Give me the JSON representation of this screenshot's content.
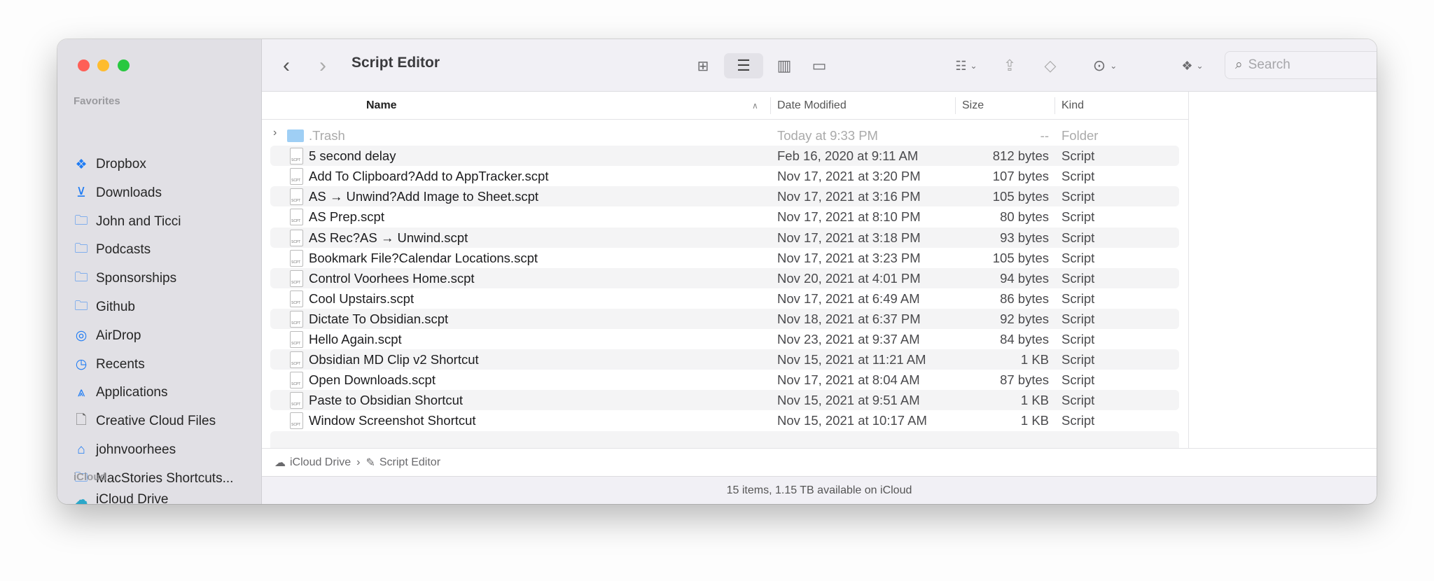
{
  "window": {
    "title": "Script Editor",
    "traffic_colors": {
      "close": "#fe5f57",
      "minimize": "#febc2e",
      "zoom": "#28c840"
    }
  },
  "toolbar": {
    "search_placeholder": "Search",
    "views": [
      "icon-view",
      "list-view",
      "column-view",
      "gallery-view"
    ],
    "selected_view": "list-view"
  },
  "sidebar": {
    "favorites_label": "Favorites",
    "favorites": [
      {
        "label": "Dropbox",
        "icon": "dropbox-icon"
      },
      {
        "label": "Downloads",
        "icon": "download-icon"
      },
      {
        "label": "John and Ticci",
        "icon": "folder-icon"
      },
      {
        "label": "Podcasts",
        "icon": "folder-icon"
      },
      {
        "label": "Sponsorships",
        "icon": "folder-icon"
      },
      {
        "label": "Github",
        "icon": "folder-icon"
      },
      {
        "label": "AirDrop",
        "icon": "airdrop-icon"
      },
      {
        "label": "Recents",
        "icon": "clock-icon"
      },
      {
        "label": "Applications",
        "icon": "applications-icon"
      },
      {
        "label": "Creative Cloud Files",
        "icon": "document-icon"
      },
      {
        "label": "johnvoorhees",
        "icon": "home-icon"
      },
      {
        "label": "MacStories Shortcuts...",
        "icon": "folder-icon"
      }
    ],
    "icloud_label": "iCloud",
    "icloud": [
      {
        "label": "iCloud Drive",
        "icon": "cloud-icon"
      }
    ]
  },
  "columns": {
    "name": "Name",
    "date": "Date Modified",
    "size": "Size",
    "kind": "Kind"
  },
  "files": [
    {
      "name": ".Trash",
      "date": "Today at 9:33 PM",
      "size": "--",
      "kind": "Folder",
      "folder": true
    },
    {
      "name": "5 second delay",
      "date": "Feb 16, 2020 at 9:11 AM",
      "size": "812 bytes",
      "kind": "Script"
    },
    {
      "name": "Add To Clipboard?Add to AppTracker.scpt",
      "date": "Nov 17, 2021 at 3:20 PM",
      "size": "107 bytes",
      "kind": "Script"
    },
    {
      "name": "AS → Unwind?Add Image to Sheet.scpt",
      "date": "Nov 17, 2021 at 3:16 PM",
      "size": "105 bytes",
      "kind": "Script"
    },
    {
      "name": "AS Prep.scpt",
      "date": "Nov 17, 2021 at 8:10 PM",
      "size": "80 bytes",
      "kind": "Script"
    },
    {
      "name": "AS Rec?AS → Unwind.scpt",
      "date": "Nov 17, 2021 at 3:18 PM",
      "size": "93 bytes",
      "kind": "Script"
    },
    {
      "name": "Bookmark File?Calendar Locations.scpt",
      "date": "Nov 17, 2021 at 3:23 PM",
      "size": "105 bytes",
      "kind": "Script"
    },
    {
      "name": "Control Voorhees Home.scpt",
      "date": "Nov 20, 2021 at 4:01 PM",
      "size": "94 bytes",
      "kind": "Script"
    },
    {
      "name": "Cool Upstairs.scpt",
      "date": "Nov 17, 2021 at 6:49 AM",
      "size": "86 bytes",
      "kind": "Script"
    },
    {
      "name": "Dictate To Obsidian.scpt",
      "date": "Nov 18, 2021 at 6:37 PM",
      "size": "92 bytes",
      "kind": "Script"
    },
    {
      "name": "Hello Again.scpt",
      "date": "Nov 23, 2021 at 9:37 AM",
      "size": "84 bytes",
      "kind": "Script"
    },
    {
      "name": "Obsidian MD Clip v2 Shortcut",
      "date": "Nov 15, 2021 at 11:21 AM",
      "size": "1 KB",
      "kind": "Script"
    },
    {
      "name": "Open Downloads.scpt",
      "date": "Nov 17, 2021 at 8:04 AM",
      "size": "87 bytes",
      "kind": "Script"
    },
    {
      "name": "Paste to Obsidian Shortcut",
      "date": "Nov 15, 2021 at 9:51 AM",
      "size": "1 KB",
      "kind": "Script"
    },
    {
      "name": "Window Screenshot Shortcut",
      "date": "Nov 15, 2021 at 10:17 AM",
      "size": "1 KB",
      "kind": "Script"
    }
  ],
  "pathbar": {
    "root": "iCloud Drive",
    "current": "Script Editor"
  },
  "status": "15 items, 1.15 TB available on iCloud"
}
